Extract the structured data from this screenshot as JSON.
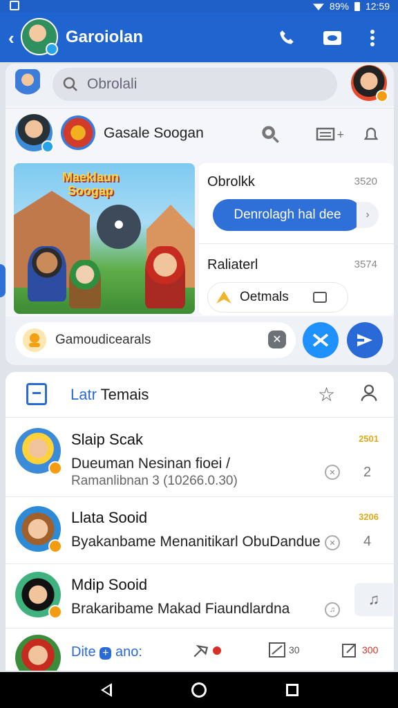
{
  "status": {
    "battery": "89%",
    "time": "12:59"
  },
  "header": {
    "title": "Garoiolan"
  },
  "search": {
    "placeholder": "Obrolali"
  },
  "group": {
    "title": "Gasale Soogan"
  },
  "post": {
    "illustration_title_line1": "Maeklaun",
    "illustration_title_line2": "Soogap",
    "item1_title": "Obrolkk",
    "item1_time": "3520",
    "item1_button": "Denrolagh hal dee",
    "item2_title": "Raliaterl",
    "item2_time": "3574",
    "item2_chip": "Oetmals"
  },
  "compose": {
    "text": "Gamoudicearals"
  },
  "list": {
    "header_part1": "Latr",
    "header_part2": " Temais",
    "rows": [
      {
        "name": "Slaip Scak",
        "line1": "Dueuman Nesinan fioei /",
        "line2": "Ramanlibnan 3 (10266.0.30)",
        "time": "2501",
        "count": "2"
      },
      {
        "name": "Llata Sooid",
        "line1": "Byakanbame Menanitikarl ObuDandue",
        "time": "3206",
        "count": "4"
      },
      {
        "name": "Mdip Sooid",
        "line1": "Brakaribame Makad Fiaundlardna"
      }
    ],
    "partial": {
      "label_a": "Dite",
      "label_tag": "+",
      "label_b": "ano:",
      "item2": "30",
      "item3": "300"
    }
  },
  "colors": {
    "primary": "#1f64cf",
    "accent": "#f39c12"
  },
  "icons": [
    "back-icon",
    "phone-icon",
    "video-icon",
    "more-icon",
    "search-icon",
    "zoom-icon",
    "list-icon",
    "bell-icon",
    "close-icon",
    "send-icon",
    "calendar-icon",
    "star-icon",
    "person-icon"
  ]
}
